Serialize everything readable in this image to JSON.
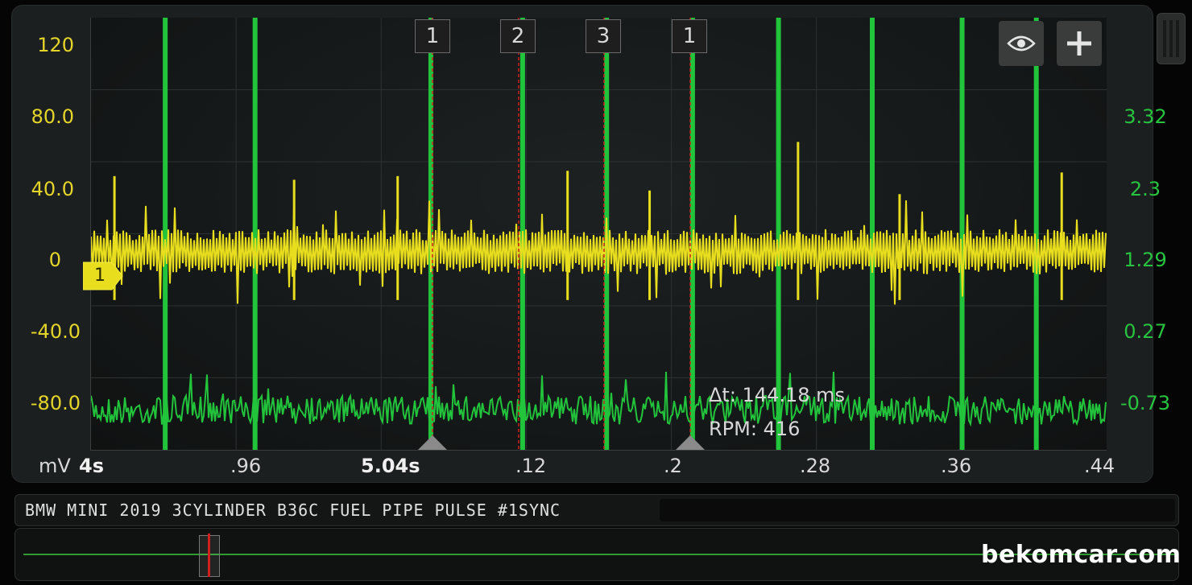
{
  "app": {
    "title": "BMW MINI 2019 3CYLINDER B36C FUEL PIPE PULSE #1SYNC",
    "watermark": "bekomcar.com"
  },
  "axes": {
    "left_unit": "mV",
    "left_ticks": [
      "120",
      "80.0",
      "40.0",
      "0",
      "-40.0",
      "-80.0"
    ],
    "right_ticks": [
      "3.32",
      "2.3",
      "1.29",
      "0.27",
      "-0.73"
    ],
    "x_ticks": [
      "4s",
      ".96",
      "5.04s",
      ".12",
      ".2",
      ".28",
      ".36",
      ".44"
    ]
  },
  "markers": [
    "1",
    "2",
    "3",
    "1"
  ],
  "channel_tag": "1",
  "measurement": {
    "delta_t": "Δt: 144.18 ms",
    "rpm": "RPM: 416"
  },
  "tools": {
    "eye": "eye-icon",
    "add": "plus-icon"
  },
  "colors": {
    "channel1": "#e8de1e",
    "channel2": "#22c43c",
    "cursor": "#d0201e"
  },
  "chart_data": {
    "type": "line",
    "x_range_s": [
      4.92,
      5.44
    ],
    "series": [
      {
        "color": "#e8de1e",
        "ylim": [
          -110,
          130
        ],
        "baseline": 0,
        "peaks": [
          {
            "x": 4.932,
            "y": 42
          },
          {
            "x": 5.024,
            "y": 40
          },
          {
            "x": 5.077,
            "y": 42
          },
          {
            "x": 5.164,
            "y": 45
          },
          {
            "x": 5.206,
            "y": 34
          },
          {
            "x": 5.282,
            "y": 61
          },
          {
            "x": 5.334,
            "y": 32
          },
          {
            "x": 5.417,
            "y": 44
          }
        ]
      },
      {
        "color": "#22c43c",
        "ylim": [
          -1.7,
          4.3
        ],
        "baseline": -1.15,
        "pulses": [
          4.958,
          5.004,
          5.094,
          5.141,
          5.184,
          5.228,
          5.272,
          5.32,
          5.366,
          5.404
        ]
      }
    ]
  }
}
